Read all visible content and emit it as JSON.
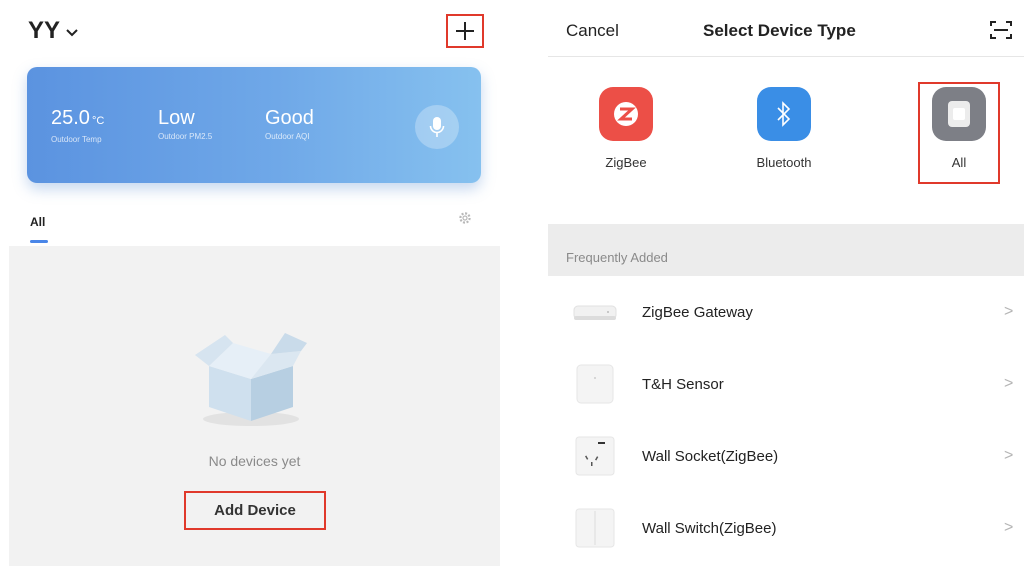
{
  "left": {
    "home_name": "YY",
    "chevron_icon": "chevron-down-icon",
    "add_icon": "plus-icon",
    "weather": {
      "temp_value": "25.0",
      "temp_unit": "°C",
      "temp_label": "Outdoor Temp",
      "pm_value": "Low",
      "pm_label": "Outdoor PM2.5",
      "aqi_value": "Good",
      "aqi_label": "Outdoor AQI",
      "mic_icon": "microphone-icon"
    },
    "tab_all": "All",
    "settings_icon": "gear-icon",
    "empty_text": "No devices yet",
    "add_device_label": "Add Device",
    "highlight_color": "#e0392b"
  },
  "right": {
    "cancel_label": "Cancel",
    "title": "Select Device Type",
    "scan_icon": "scan-icon",
    "types": [
      {
        "label": "ZigBee",
        "icon": "zigbee-icon",
        "color": "#ec4f47"
      },
      {
        "label": "Bluetooth",
        "icon": "bluetooth-icon",
        "color": "#3a8ee6"
      },
      {
        "label": "All",
        "icon": "all-devices-icon",
        "color": "#7d7f86"
      }
    ],
    "section_label": "Frequently Added",
    "devices": [
      {
        "name": "ZigBee Gateway",
        "icon": "gateway-icon"
      },
      {
        "name": "T&H Sensor",
        "icon": "sensor-icon"
      },
      {
        "name": "Wall Socket(ZigBee)",
        "icon": "socket-icon"
      },
      {
        "name": "Wall Switch(ZigBee)",
        "icon": "switch-icon"
      }
    ],
    "row_arrow": ">"
  }
}
